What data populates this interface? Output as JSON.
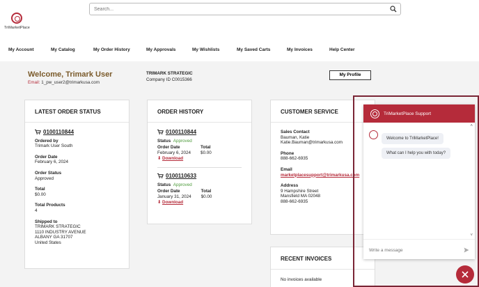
{
  "logo": {
    "text": "TriMarketPlace"
  },
  "search": {
    "placeholder": "Search..."
  },
  "nav": [
    {
      "label": "My Account"
    },
    {
      "label": "My Catalog"
    },
    {
      "label": "My Order History"
    },
    {
      "label": "My Approvals"
    },
    {
      "label": "My Wishlists"
    },
    {
      "label": "My Saved Carts"
    },
    {
      "label": "My Invoices"
    },
    {
      "label": "Help Center"
    }
  ],
  "welcome": {
    "title": "Welcome, Trimark User",
    "email_label": "Email:",
    "email": "1_pw_user2@trimarkusa.com",
    "company_name": "TRIMARK STRATEGIC",
    "company_id": "Company ID C0015366",
    "profile_button": "My Profile"
  },
  "latest_order": {
    "title": "LATEST ORDER STATUS",
    "order_number": "0100110844",
    "ordered_by_label": "Ordered by",
    "ordered_by": "Trimark User South",
    "order_date_label": "Order Date",
    "order_date": "February 6, 2024",
    "status_label": "Order Status",
    "status": "Approved",
    "total_label": "Total",
    "total": "$0.00",
    "products_label": "Total Products",
    "products": "4",
    "shipped_label": "Shipped to",
    "address": [
      "TRIMARK STRATEGIC",
      "1110 INDUSTRY AVENUE",
      "ALBANY GA 31707",
      "United States"
    ]
  },
  "order_history": {
    "title": "ORDER HISTORY",
    "orders": [
      {
        "number": "0100110844",
        "status_label": "Status",
        "status": "Approved",
        "date_label": "Order Date",
        "date": "February 6, 2024",
        "total_label": "Total",
        "total": "$0.00",
        "download": "Download"
      },
      {
        "number": "0100110633",
        "status_label": "Status",
        "status": "Approved",
        "date_label": "Order Date",
        "date": "January 31, 2024",
        "total_label": "Total",
        "total": "$0.00",
        "download": "Download"
      }
    ]
  },
  "customer_service": {
    "title": "CUSTOMER SERVICE",
    "sales_label": "Sales Contact",
    "sales_name": "Bauman, Katie",
    "sales_email": "Katie.Bauman@trimarkusa.com",
    "phone_label": "Phone",
    "phone": "888-662-6935",
    "email_label": "Email",
    "email": "marketplacesupport@trimarkusa.com",
    "address_label": "Address",
    "address": [
      "9 Hampshire Street",
      "Mansfield MA 02048",
      "888-662-6935"
    ]
  },
  "recent_invoices": {
    "title": "RECENT INVOICES",
    "empty": "No invoices available"
  },
  "chat": {
    "header": "TriMarketPlace Support",
    "messages": [
      "Welcome to TriMarketPlace!",
      "What can I help you with today?"
    ],
    "input_placeholder": "Write a message"
  },
  "colors": {
    "brand": "#b52b3a",
    "heading": "#7a5a2a",
    "approved": "#4c9a3a"
  }
}
